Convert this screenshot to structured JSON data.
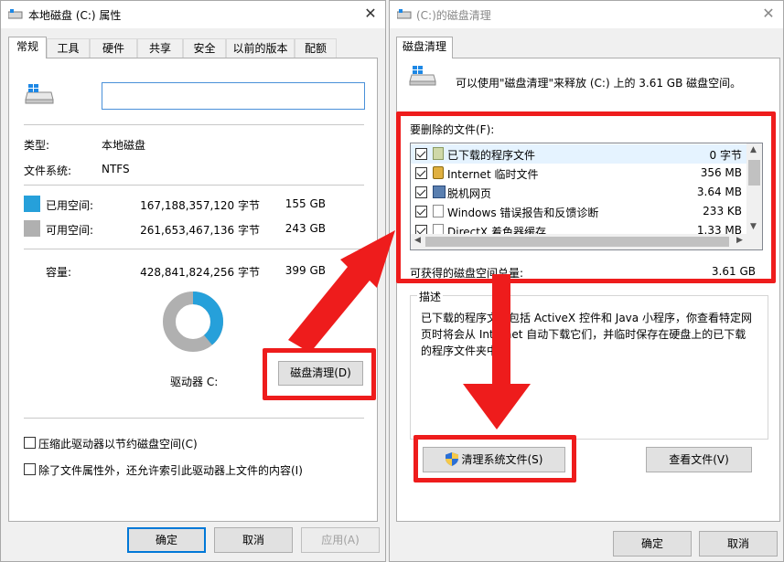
{
  "left_dialog": {
    "title": "本地磁盘 (C:) 属性",
    "tabs": [
      "常规",
      "工具",
      "硬件",
      "共享",
      "安全",
      "以前的版本",
      "配额"
    ],
    "name_value": "",
    "type_label": "类型:",
    "type_value": "本地磁盘",
    "fs_label": "文件系统:",
    "fs_value": "NTFS",
    "used_label": "已用空间:",
    "used_bytes": "167,188,357,120 字节",
    "used_gb": "155 GB",
    "free_label": "可用空间:",
    "free_bytes": "261,653,467,136 字节",
    "free_gb": "243 GB",
    "cap_label": "容量:",
    "cap_bytes": "428,841,824,256 字节",
    "cap_gb": "399 GB",
    "drive_label": "驱动器 C:",
    "cleanup_button": "磁盘清理(D)",
    "compress_label": "压缩此驱动器以节约磁盘空间(C)",
    "index_label": "除了文件属性外，还允许索引此驱动器上文件的内容(I)",
    "ok": "确定",
    "cancel": "取消",
    "apply": "应用(A)",
    "used_fraction": 0.39,
    "colors": {
      "used": "#26a0da",
      "free": "#b0b0b0"
    }
  },
  "right_dialog": {
    "title": "(C:)的磁盘清理",
    "tab": "磁盘清理",
    "intro": "可以使用\"磁盘清理\"来释放  (C:) 上的 3.61 GB 磁盘空间。",
    "files_label": "要删除的文件(F):",
    "files": [
      {
        "name": "已下载的程序文件",
        "size": "0 字节",
        "checked": true,
        "icon": "folder-icon"
      },
      {
        "name": "Internet 临时文件",
        "size": "356 MB",
        "checked": true,
        "icon": "lock-icon"
      },
      {
        "name": "脱机网页",
        "size": "3.64 MB",
        "checked": true,
        "icon": "offline-icon"
      },
      {
        "name": "Windows 错误报告和反馈诊断",
        "size": "233 KB",
        "checked": true,
        "icon": "file-icon"
      },
      {
        "name": "DirectX 着色器缓存",
        "size": "1.33 MB",
        "checked": true,
        "icon": "file-icon"
      }
    ],
    "total_label": "可获得的磁盘空间总量:",
    "total_value": "3.61 GB",
    "desc_title": "描述",
    "desc_text": "已下载的程序文件包括 ActiveX 控件和 Java 小程序，你查看特定网页时将会从 Internet 自动下载它们，并临时保存在硬盘上的已下载的程序文件夹中。",
    "sys_button": "清理系统文件(S)",
    "view_button": "查看文件(V)",
    "ok": "确定",
    "cancel": "取消"
  }
}
